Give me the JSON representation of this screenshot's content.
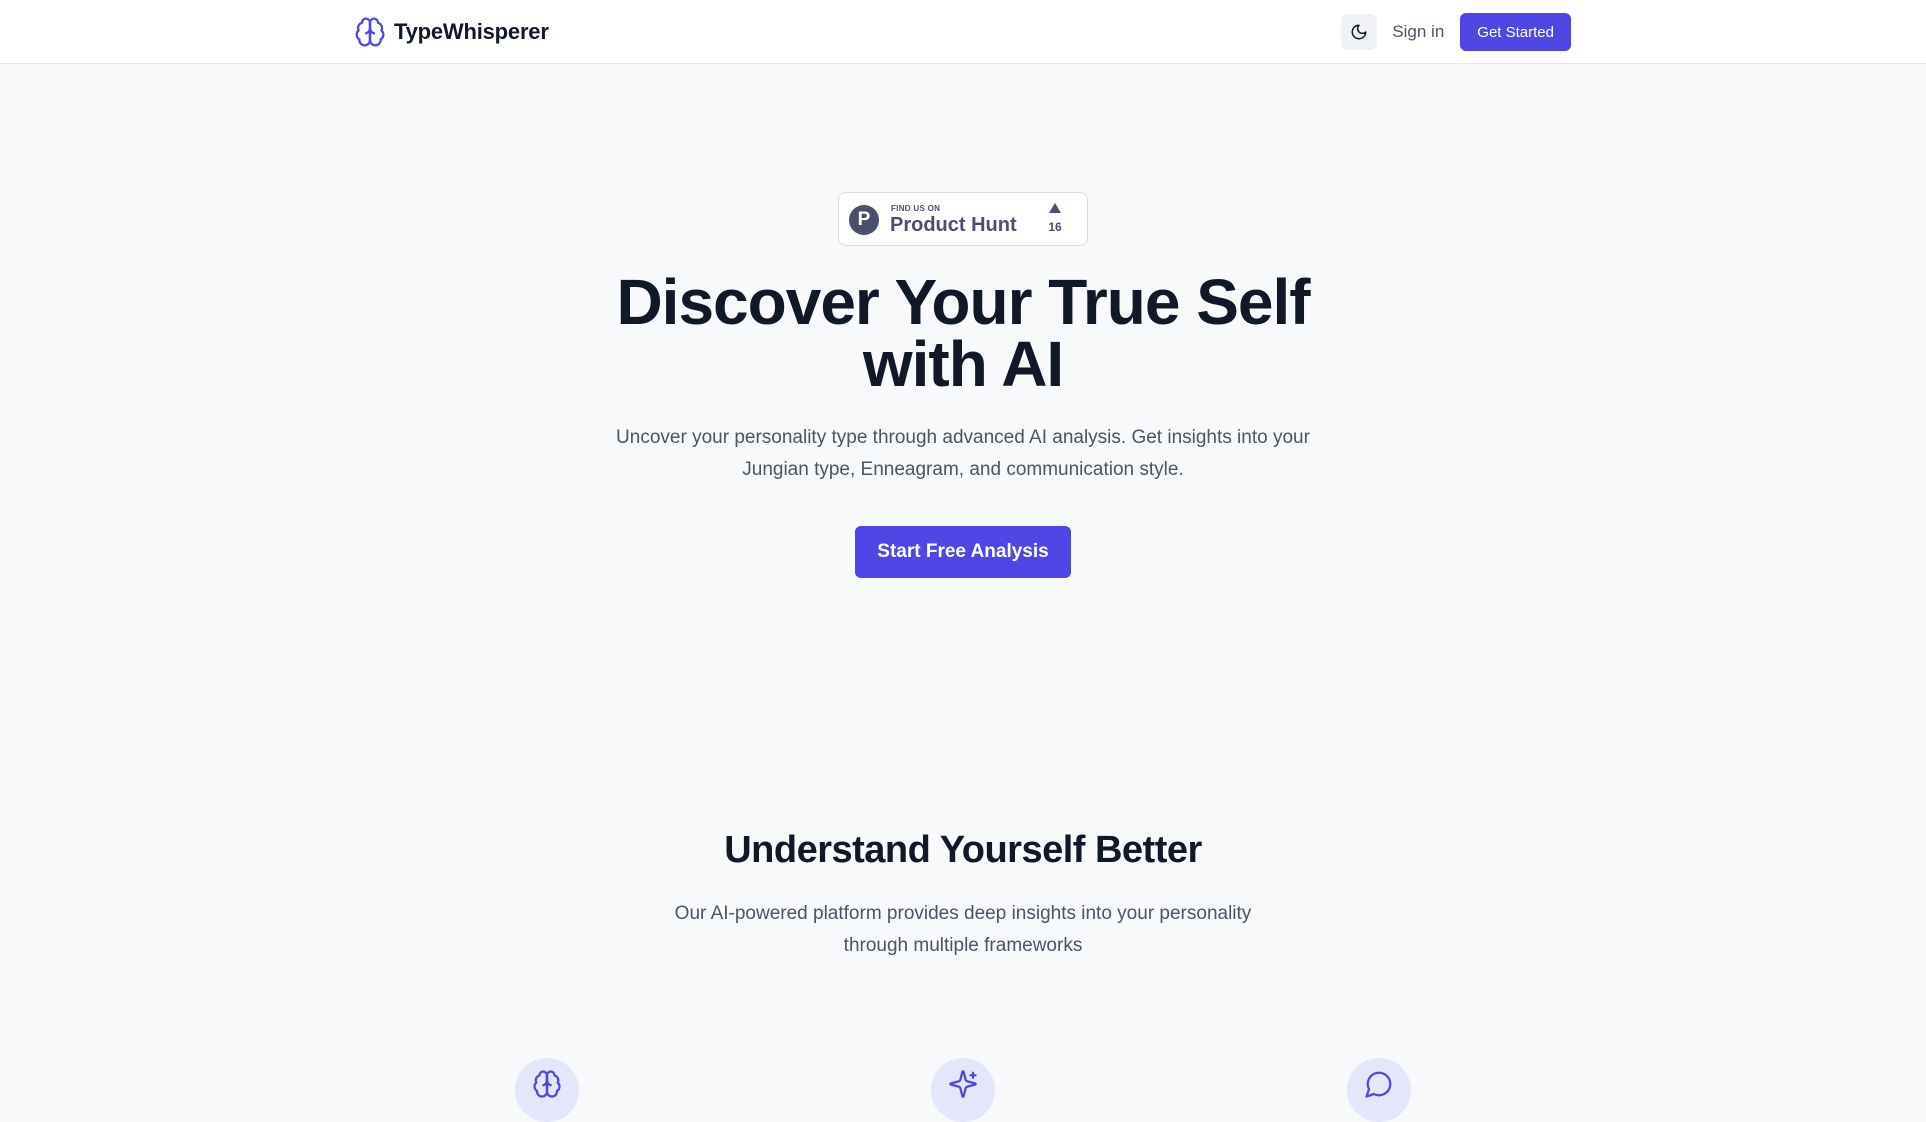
{
  "nav": {
    "brand": "TypeWhisperer",
    "brand_icon": "brain-icon",
    "theme_icon": "moon-icon",
    "signin_label": "Sign in",
    "get_started_label": "Get Started"
  },
  "product_hunt": {
    "small_text": "FIND US ON",
    "big_text": "Product Hunt",
    "logo_letter": "P",
    "upvotes": "16"
  },
  "hero": {
    "title": "Discover Your True Self with AI",
    "subtitle": "Uncover your personality type through advanced AI analysis. Get insights into your Jungian type, Enneagram, and communication style.",
    "cta_label": "Start Free Analysis"
  },
  "features": {
    "title": "Understand Yourself Better",
    "subtitle": "Our AI-powered platform provides deep insights into your personality through multiple frameworks",
    "icons": [
      "brain-icon",
      "sparkles-icon",
      "message-circle-icon"
    ]
  },
  "colors": {
    "accent": "#4f46e5",
    "background": "#f8f9fb",
    "text_primary": "#111827",
    "text_secondary": "#4b5563",
    "icon_bg": "#e4e6f9"
  }
}
